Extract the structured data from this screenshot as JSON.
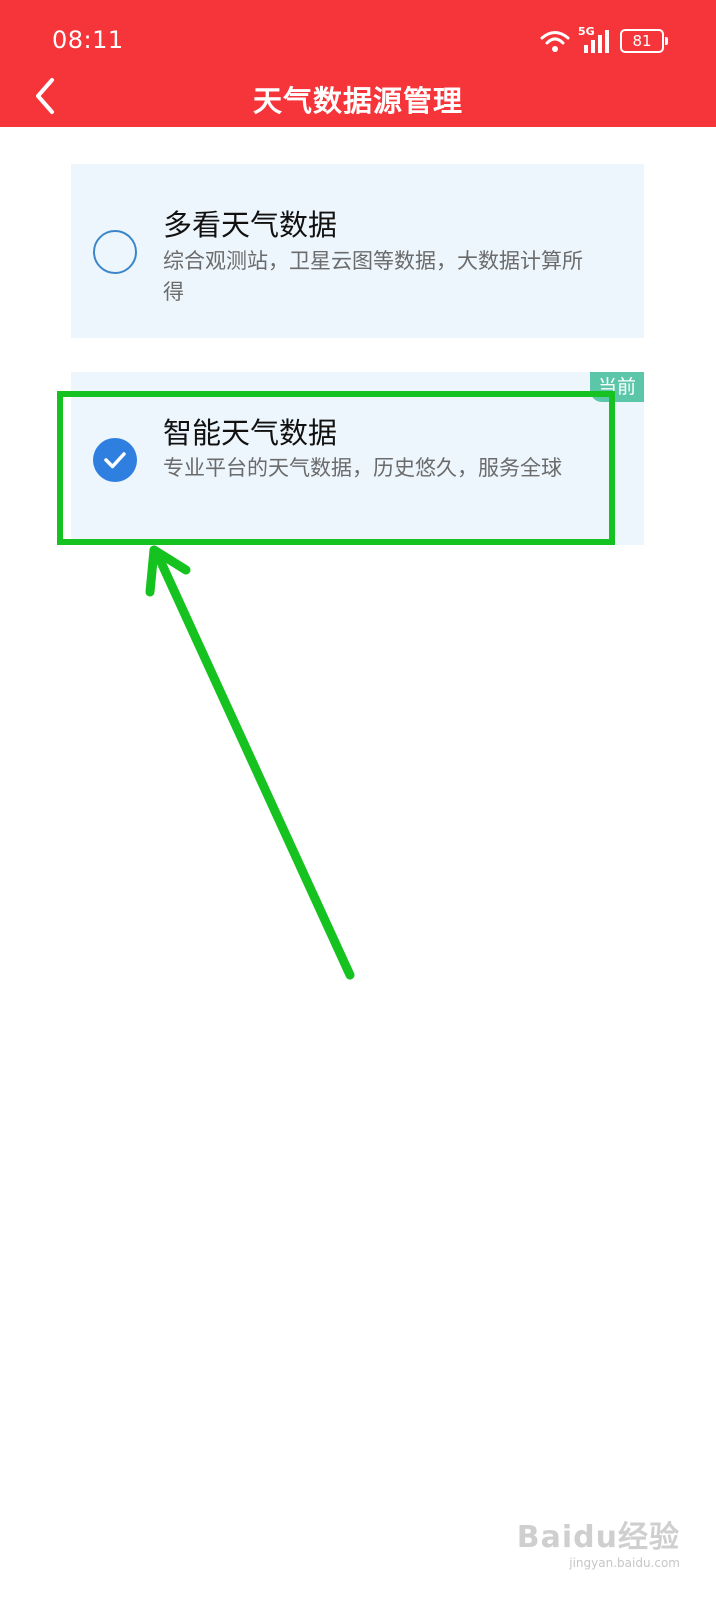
{
  "status_bar": {
    "time": "08:11",
    "network": "5G",
    "battery": "81"
  },
  "header": {
    "title": "天气数据源管理",
    "background_color": "#f5353a"
  },
  "options": [
    {
      "title": "多看天气数据",
      "description": "综合观测站，卫星云图等数据，大数据计算所得",
      "selected": false
    },
    {
      "title": "智能天气数据",
      "description": "专业平台的天气数据，历史悠久，服务全球",
      "selected": true,
      "badge": "当前"
    }
  ],
  "accent_colors": {
    "selected": "#2f7fe0",
    "badge": "#5cc7a8",
    "annotation": "#15c21f"
  },
  "watermark": {
    "logo": "Baidu经验",
    "url": "jingyan.baidu.com"
  }
}
